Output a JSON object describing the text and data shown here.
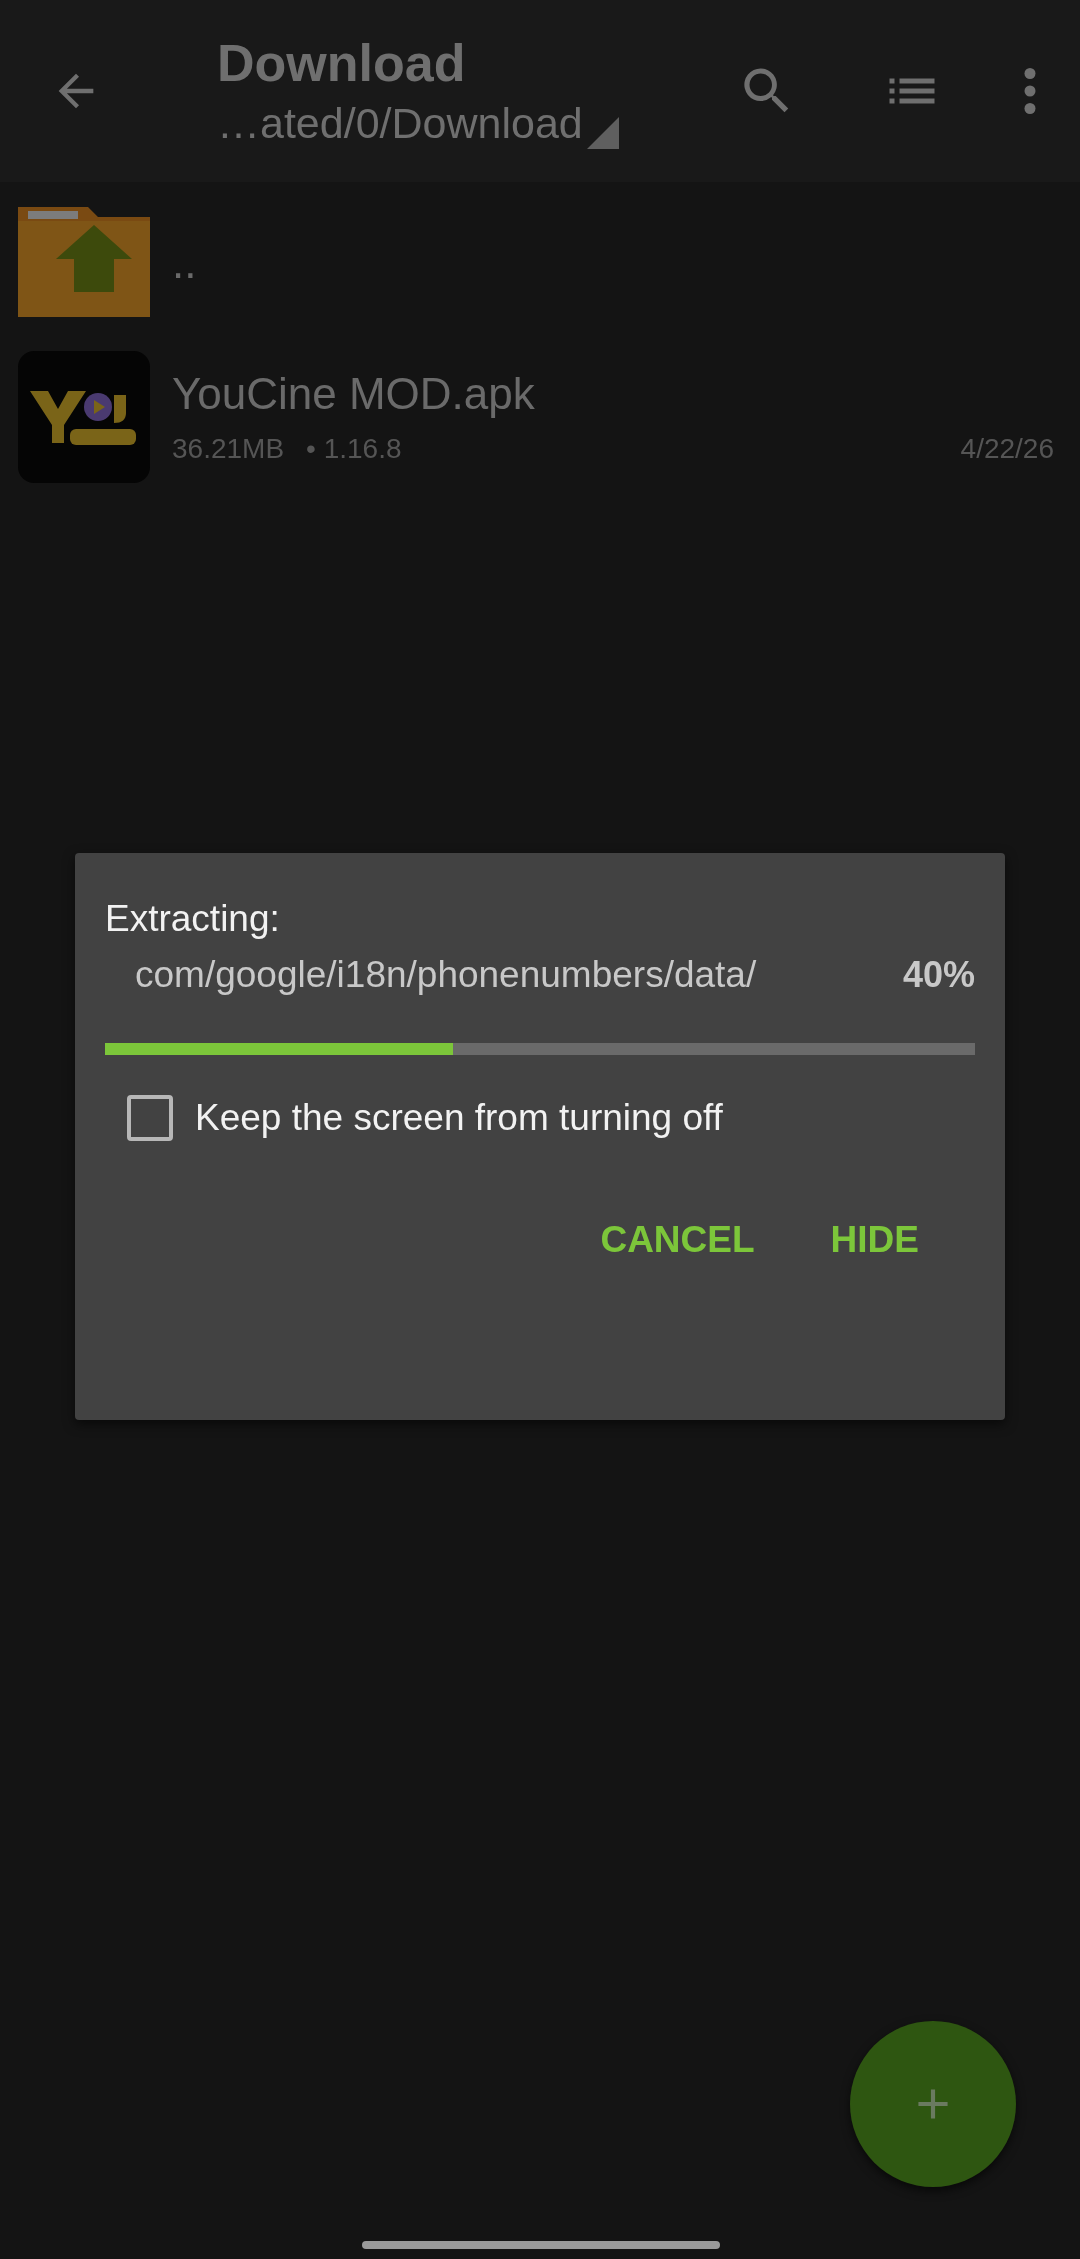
{
  "toolbar": {
    "title": "Download",
    "path": "…ated/0/Download"
  },
  "files": [
    {
      "kind": "parent",
      "name": ".."
    },
    {
      "kind": "apk",
      "name": "YouCine MOD.apk",
      "size": "36.21MB",
      "version": "• 1.16.8",
      "date": "4/22/26"
    }
  ],
  "dialog": {
    "heading": "Extracting:",
    "path": "com/google/i18n/phonenumbers/data/",
    "percent": "40%",
    "progress": {
      "level": 0.4
    },
    "keep_screen_on": {
      "label": "Keep the screen from turning off",
      "checked": false
    },
    "buttons": [
      "CANCEL",
      "HIDE"
    ]
  }
}
